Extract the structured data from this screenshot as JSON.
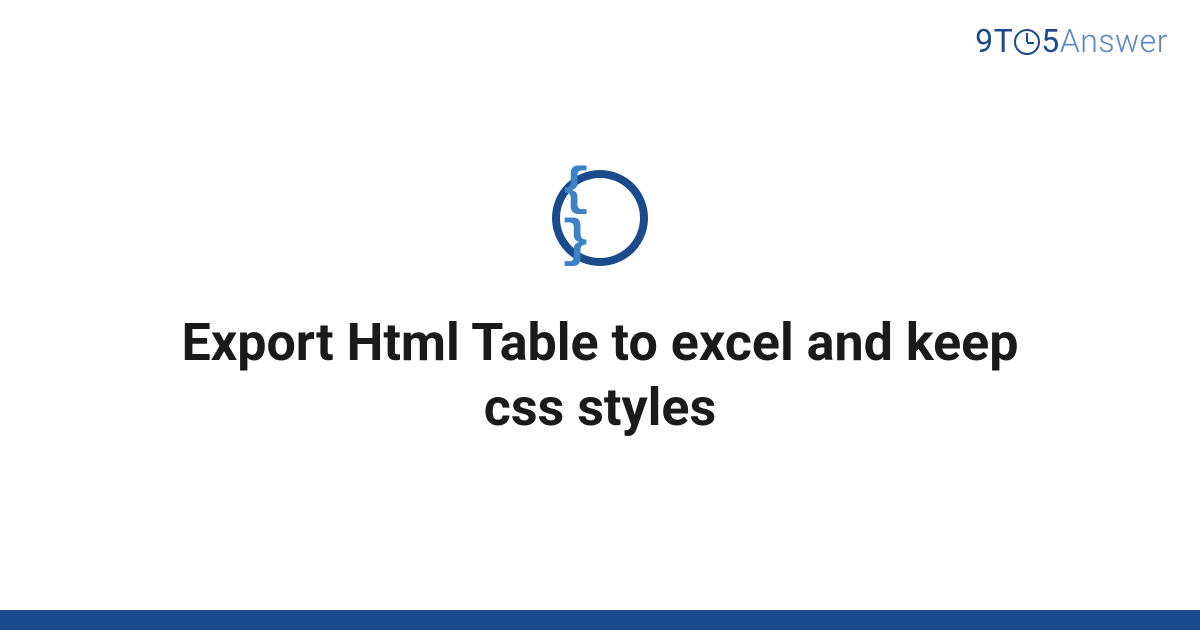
{
  "brand": {
    "part1": "9",
    "part2": "T",
    "part3": "5",
    "part4": "Answer"
  },
  "category_icon": {
    "name": "css-braces-icon",
    "glyph": "{ }"
  },
  "title": "Export Html Table to excel and keep css styles",
  "colors": {
    "brand_primary": "#1a4b8c",
    "brand_light": "#5a87c4",
    "icon_inner": "#3b82c7",
    "text": "#1a1a1a"
  }
}
